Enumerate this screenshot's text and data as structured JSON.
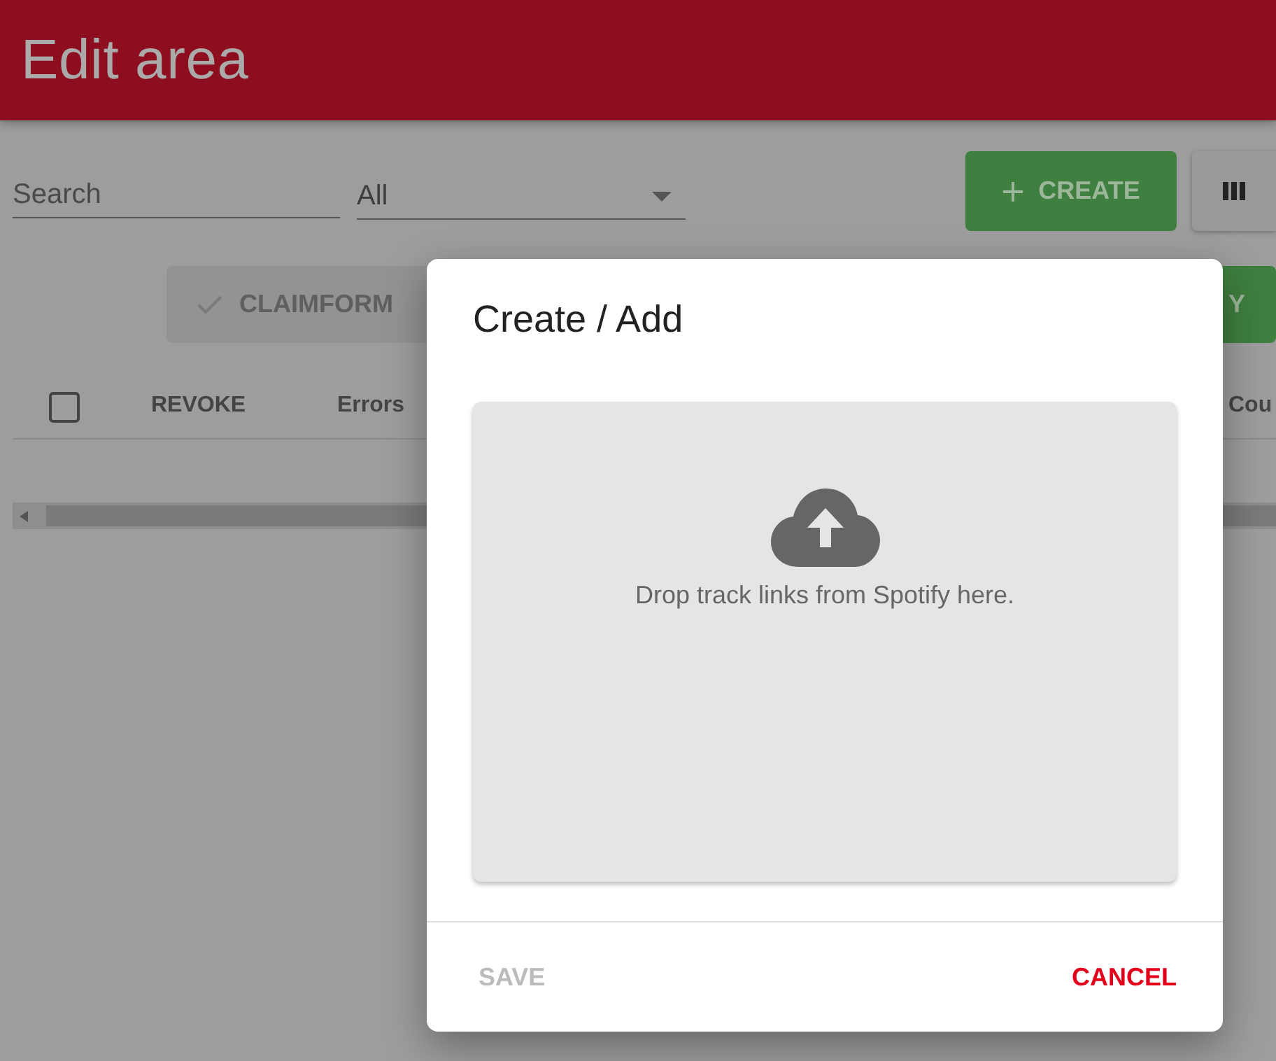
{
  "header": {
    "title": "Edit area"
  },
  "toolbar": {
    "search": {
      "placeholder": "Search"
    },
    "filter": {
      "value": "All"
    },
    "create_button": {
      "label": "CREATE"
    }
  },
  "actions": [
    {
      "label": "CLAIMFORM",
      "kind": "check",
      "disabled": true
    },
    {
      "label": "Y",
      "kind": "plain",
      "disabled": false
    }
  ],
  "table": {
    "select_all": {
      "checked": false
    },
    "columns": [
      "REVOKE",
      "Errors",
      "Cou"
    ]
  },
  "dialog": {
    "title": "Create / Add",
    "dropzone": {
      "text": "Drop track links from Spotify here."
    },
    "buttons": [
      {
        "label": "SAVE",
        "kind": "save",
        "disabled": true
      },
      {
        "label": "CANCEL",
        "kind": "cancel",
        "disabled": false
      }
    ]
  }
}
